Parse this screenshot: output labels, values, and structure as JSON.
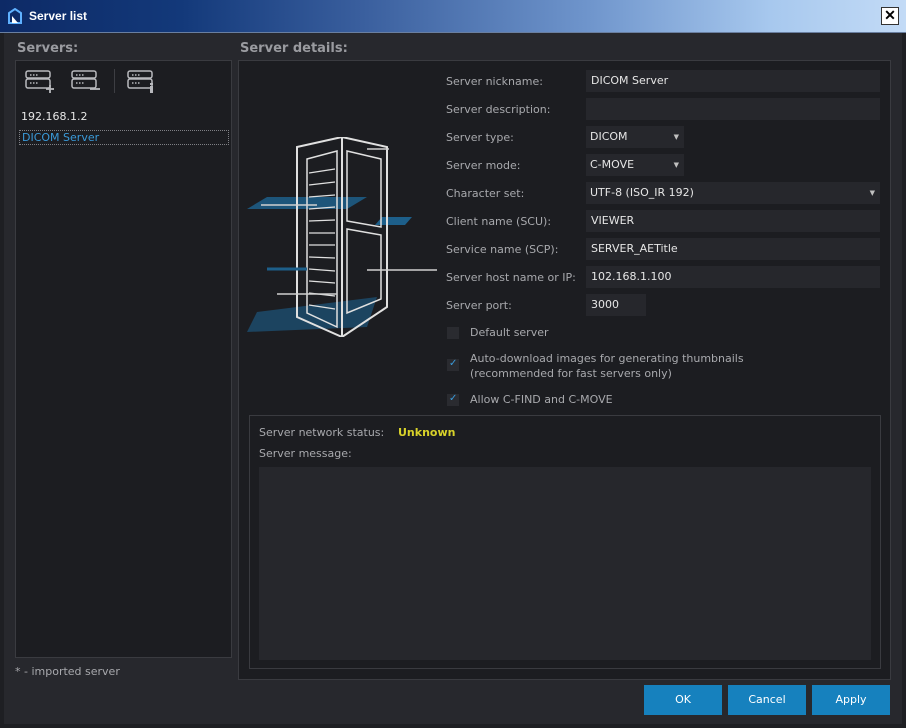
{
  "window": {
    "title": "Server list",
    "close_label": "✕"
  },
  "colors": {
    "accent": "#1681be",
    "selection_text": "#3a9ad9",
    "status_unknown": "#d8d22a"
  },
  "servers_panel": {
    "header": "Servers:",
    "toolbar": [
      {
        "name": "add-server-icon"
      },
      {
        "name": "remove-server-icon"
      },
      {
        "name": "server-info-icon"
      }
    ],
    "items": [
      {
        "label": "192.168.1.2",
        "selected": false
      },
      {
        "label": "DICOM Server",
        "selected": true
      }
    ],
    "footnote": "* - imported server"
  },
  "details": {
    "header": "Server details:",
    "fields": {
      "nickname": {
        "label": "Server nickname:",
        "value": "DICOM Server"
      },
      "description": {
        "label": "Server description:",
        "value": ""
      },
      "type": {
        "label": "Server type:",
        "value": "DICOM"
      },
      "mode": {
        "label": "Server mode:",
        "value": "C-MOVE"
      },
      "charset": {
        "label": "Character set:",
        "value": "UTF-8 (ISO_IR 192)"
      },
      "client_name": {
        "label": "Client name (SCU):",
        "value": "VIEWER"
      },
      "service_name": {
        "label": "Service name (SCP):",
        "value": "SERVER_AETitle"
      },
      "host": {
        "label": "Server host name or IP:",
        "value": "102.168.1.100"
      },
      "port": {
        "label": "Server port:",
        "value": "3000"
      }
    },
    "checkboxes": {
      "default_server": {
        "label": "Default server",
        "checked": false
      },
      "auto_download": {
        "label_line1": "Auto-download images for generating thumbnails",
        "label_line2": "(recommended for fast servers only)",
        "checked": true
      },
      "allow_cfind": {
        "label": "Allow C-FIND and C-MOVE",
        "checked": true
      }
    },
    "status": {
      "label": "Server network status:",
      "value": "Unknown",
      "message_label": "Server message:",
      "message": ""
    }
  },
  "buttons": {
    "ok": "OK",
    "cancel": "Cancel",
    "apply": "Apply"
  }
}
